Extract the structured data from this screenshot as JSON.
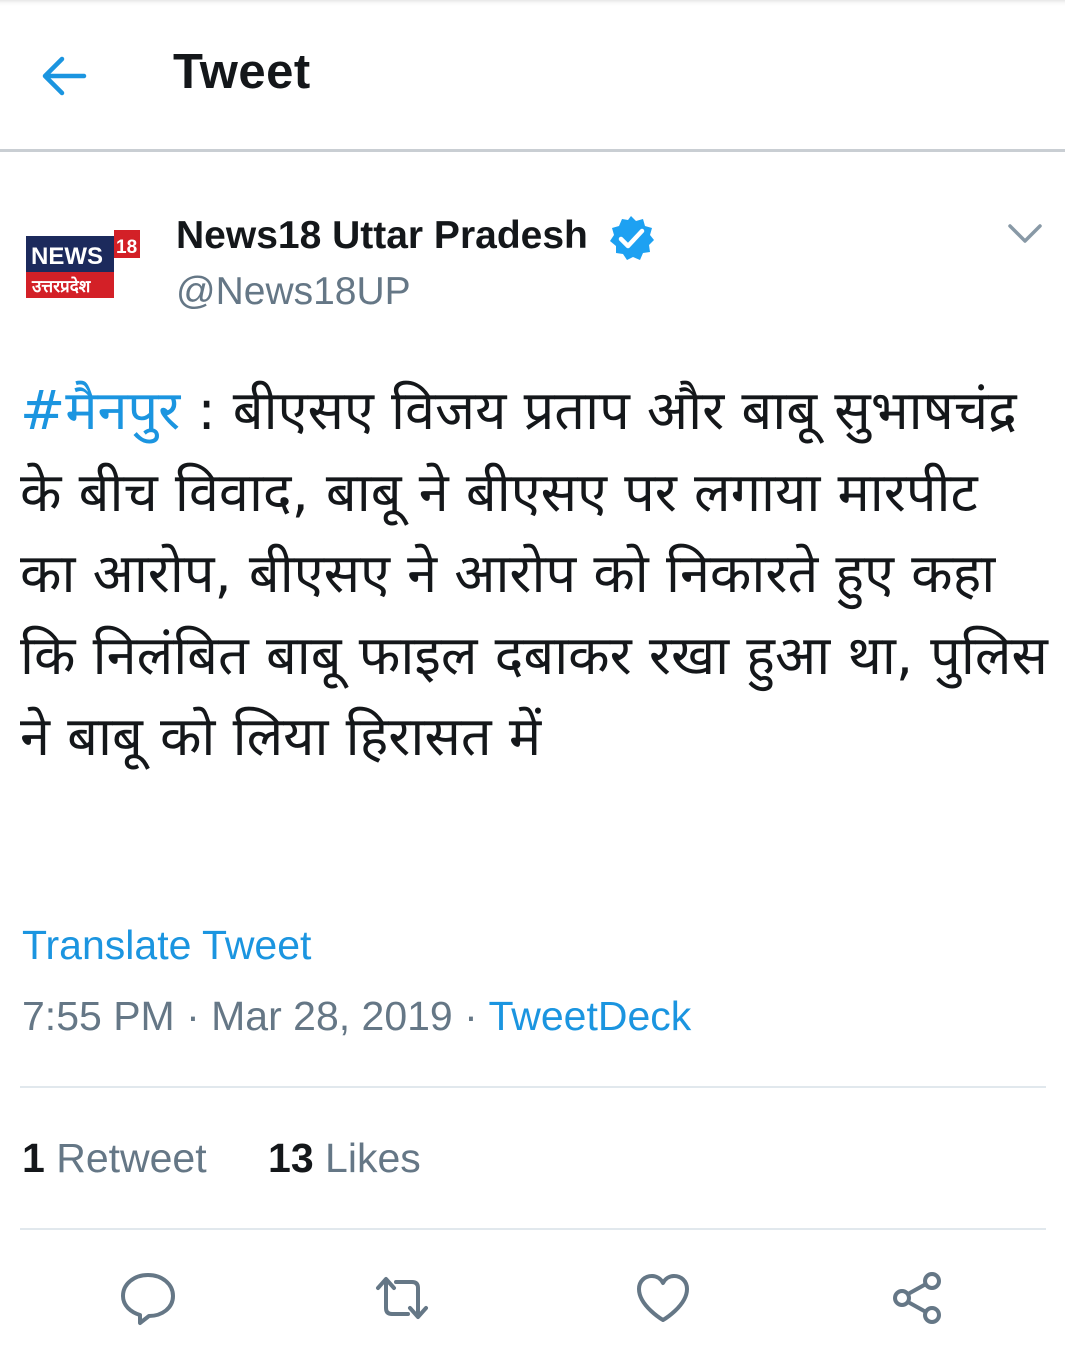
{
  "header": {
    "title": "Tweet",
    "back_icon": "arrow-left-icon"
  },
  "author": {
    "avatar": {
      "logo_word": "NEWS",
      "logo_number": "18",
      "logo_subtitle": "उत्तरप्रदेश"
    },
    "name": "News18 Uttar Pradesh",
    "verified": true,
    "handle": "@News18UP"
  },
  "tweet": {
    "hashtag": "#मैनपुर",
    "text": " : बीएसए विजय प्रताप और बाबू सुभाषचंद्र के बीच विवाद, बाबू ने बीएसए पर लगाया मारपीट का आरोप, बीएसए ने आरोप को निकारते हुए कहा कि निलंबित बाबू फाइल दबाकर रखा हुआ था, पुलिस ने बाबू को लिया हिरासत में",
    "translate_label": "Translate Tweet",
    "time": "7:55 PM",
    "date": "Mar 28, 2019",
    "separator": " · ",
    "source": "TweetDeck"
  },
  "stats": {
    "retweets_count": "1",
    "retweets_label": " Retweet",
    "likes_count": "13",
    "likes_label": " Likes"
  },
  "actions": [
    "reply-icon",
    "retweet-icon",
    "like-icon",
    "share-icon"
  ],
  "colors": {
    "accent": "#1b95e0",
    "secondary_text": "#657786",
    "primary_text": "#14171a",
    "divider": "#e1e8ed",
    "logo_red": "#d32027",
    "logo_navy": "#1c2a5c"
  }
}
